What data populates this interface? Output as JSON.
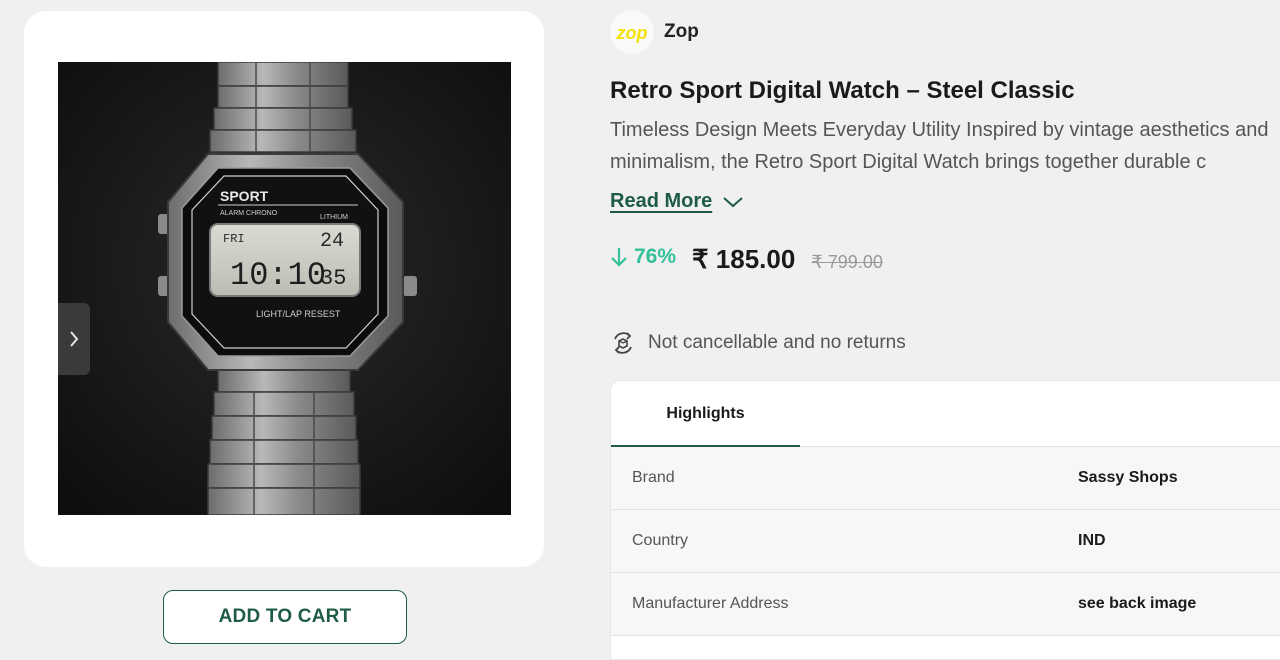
{
  "product": {
    "image_alt": "Retro digital steel watch",
    "add_to_cart_label": "ADD TO CART"
  },
  "watch_face": {
    "brand": "SPORT",
    "subtitle": "ALARM CHRONO",
    "battery": "LITHIUM",
    "day": "FRI",
    "date": "24",
    "time": "10:10",
    "seconds": "35",
    "button_label": "LIGHT/LAP RESEST"
  },
  "seller": {
    "logo_text": "zop",
    "name": "Zop"
  },
  "title": "Retro Sport Digital Watch – Steel Classic",
  "description_lines": [
    "Timeless Design Meets Everyday Utility Inspired by vintage aesthetics and",
    "minimalism, the Retro Sport Digital Watch brings together durable c"
  ],
  "read_more": "Read More",
  "pricing": {
    "discount": "76%",
    "price": "₹ 185.00",
    "mrp": "₹ 799.00"
  },
  "policy": "Not cancellable and no returns",
  "tabs": [
    {
      "label": "Highlights"
    }
  ],
  "specs": [
    {
      "key": "Brand",
      "value": "Sassy Shops"
    },
    {
      "key": "Country",
      "value": "IND"
    },
    {
      "key": "Manufacturer Address",
      "value": "see back image"
    }
  ],
  "colors": {
    "accent_green": "#1f5c44",
    "discount_green": "#33c09a",
    "logo_yellow": "#f5e20a"
  }
}
